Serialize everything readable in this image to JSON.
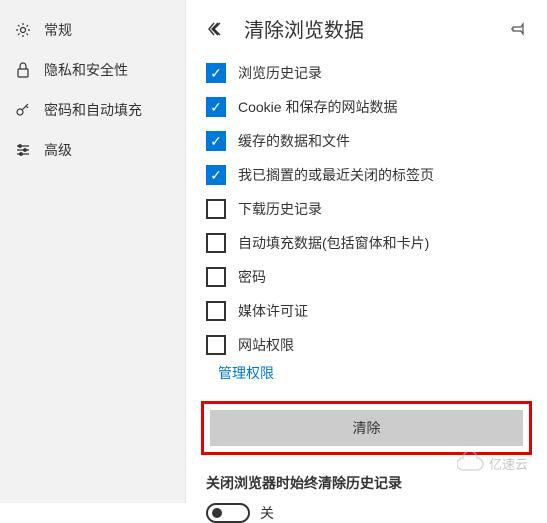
{
  "sidebar": {
    "items": [
      {
        "label": "常规"
      },
      {
        "label": "隐私和安全性"
      },
      {
        "label": "密码和自动填充"
      },
      {
        "label": "高级"
      }
    ]
  },
  "panel": {
    "title": "清除浏览数据"
  },
  "options": [
    {
      "label": "浏览历史记录",
      "checked": true
    },
    {
      "label": "Cookie 和保存的网站数据",
      "checked": true
    },
    {
      "label": "缓存的数据和文件",
      "checked": true
    },
    {
      "label": "我已搁置的或最近关闭的标签页",
      "checked": true
    },
    {
      "label": "下载历史记录",
      "checked": false
    },
    {
      "label": "自动填充数据(包括窗体和卡片)",
      "checked": false
    },
    {
      "label": "密码",
      "checked": false
    },
    {
      "label": "媒体许可证",
      "checked": false
    },
    {
      "label": "网站权限",
      "checked": false
    }
  ],
  "manage_link": "管理权限",
  "clear_button": "清除",
  "toggle_section": {
    "label": "关闭浏览器时始终清除历史记录",
    "state": "关"
  },
  "watermark": "亿速云"
}
